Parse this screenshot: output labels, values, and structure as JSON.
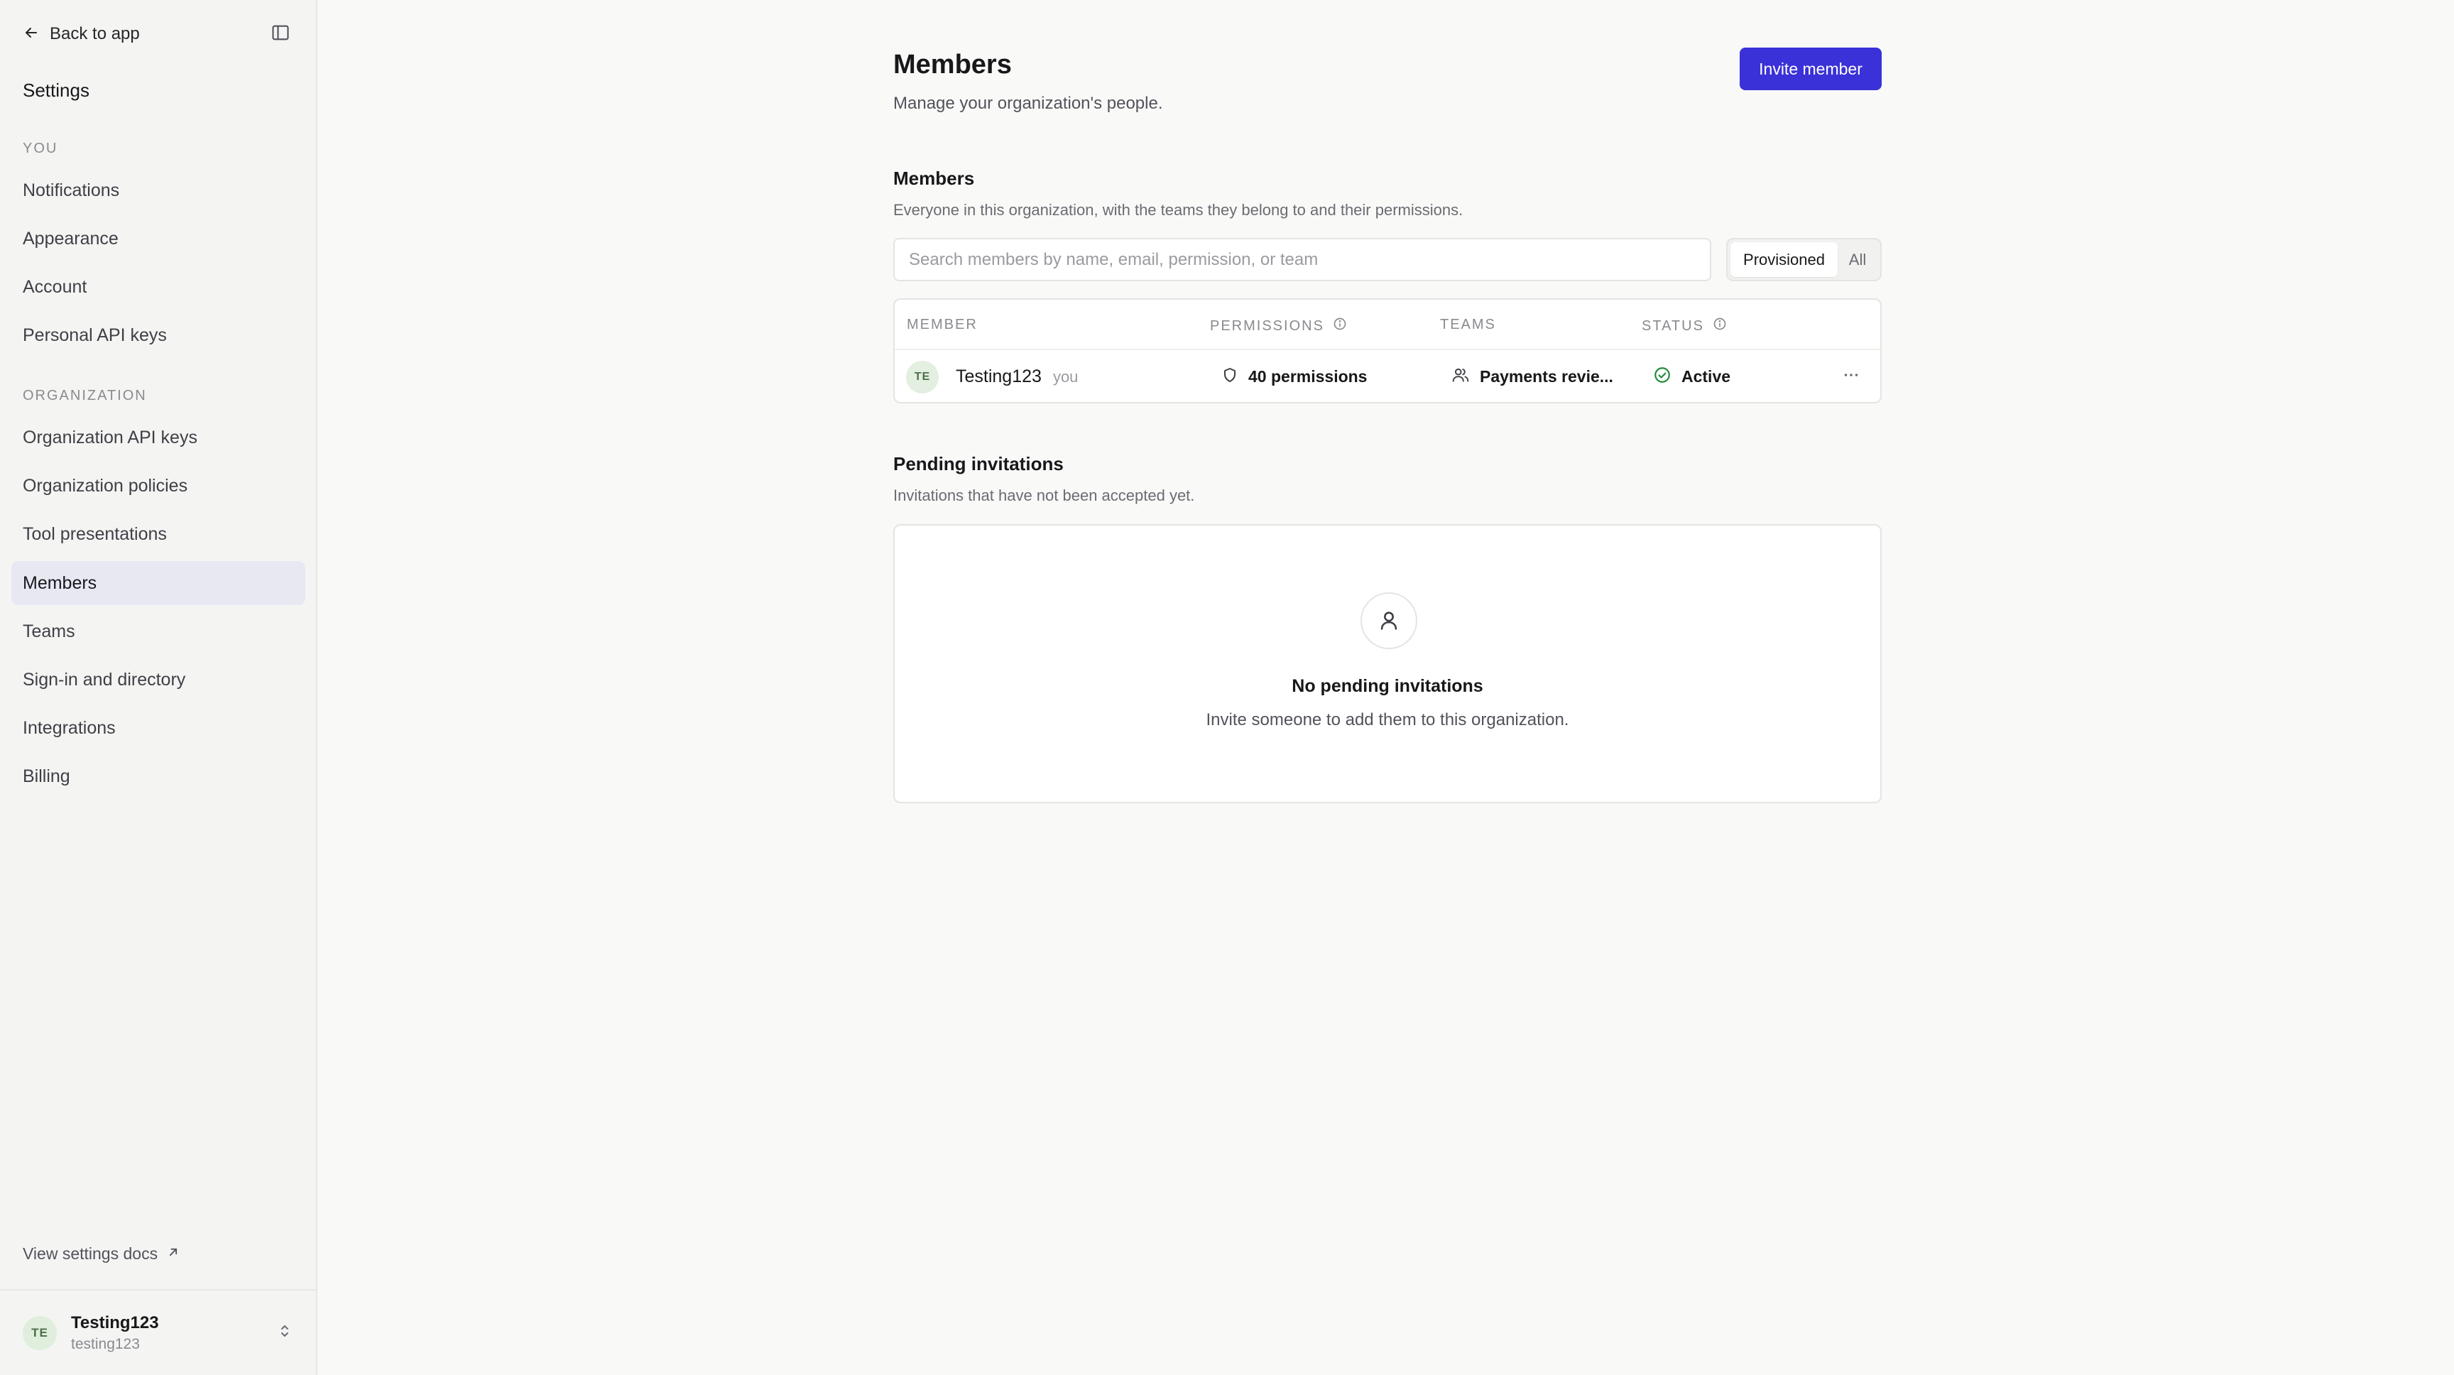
{
  "sidebar": {
    "back_label": "Back to app",
    "title": "Settings",
    "section_you": "YOU",
    "you_items": [
      {
        "label": "Notifications",
        "icon": "bell-icon"
      },
      {
        "label": "Appearance"
      },
      {
        "label": "Account"
      },
      {
        "label": "Personal API keys"
      }
    ],
    "section_org": "ORGANIZATION",
    "org_items": [
      {
        "label": "Organization API keys"
      },
      {
        "label": "Organization policies"
      },
      {
        "label": "Tool presentations"
      },
      {
        "label": "Members",
        "active": true
      },
      {
        "label": "Teams"
      },
      {
        "label": "Sign-in and directory"
      },
      {
        "label": "Integrations"
      },
      {
        "label": "Billing"
      }
    ],
    "docs_label": "View settings docs",
    "user": {
      "initials": "TE",
      "name": "Testing123",
      "handle": "testing123"
    }
  },
  "header": {
    "title": "Members",
    "subtitle": "Manage your organization's people.",
    "invite_label": "Invite member"
  },
  "members_section": {
    "title": "Members",
    "description": "Everyone in this organization, with the teams they belong to and their permissions.",
    "search_placeholder": "Search members by name, email, permission, or team",
    "filter_options": [
      "Provisioned",
      "All"
    ],
    "filter_selected": "Provisioned",
    "columns": {
      "member": "MEMBER",
      "permissions": "PERMISSIONS",
      "teams": "TEAMS",
      "status": "STATUS"
    },
    "rows": [
      {
        "initials": "TE",
        "name": "Testing123",
        "tag": "you",
        "permissions": "40 permissions",
        "teams": "Payments revie...",
        "status": "Active"
      }
    ]
  },
  "pending_section": {
    "title": "Pending invitations",
    "description": "Invitations that have not been accepted yet.",
    "empty_title": "No pending invitations",
    "empty_description": "Invite someone to add them to this organization."
  },
  "colors": {
    "accent": "#3a31d8",
    "active_nav_bg": "#e8e8f3",
    "status_active": "#1f8a3b"
  }
}
